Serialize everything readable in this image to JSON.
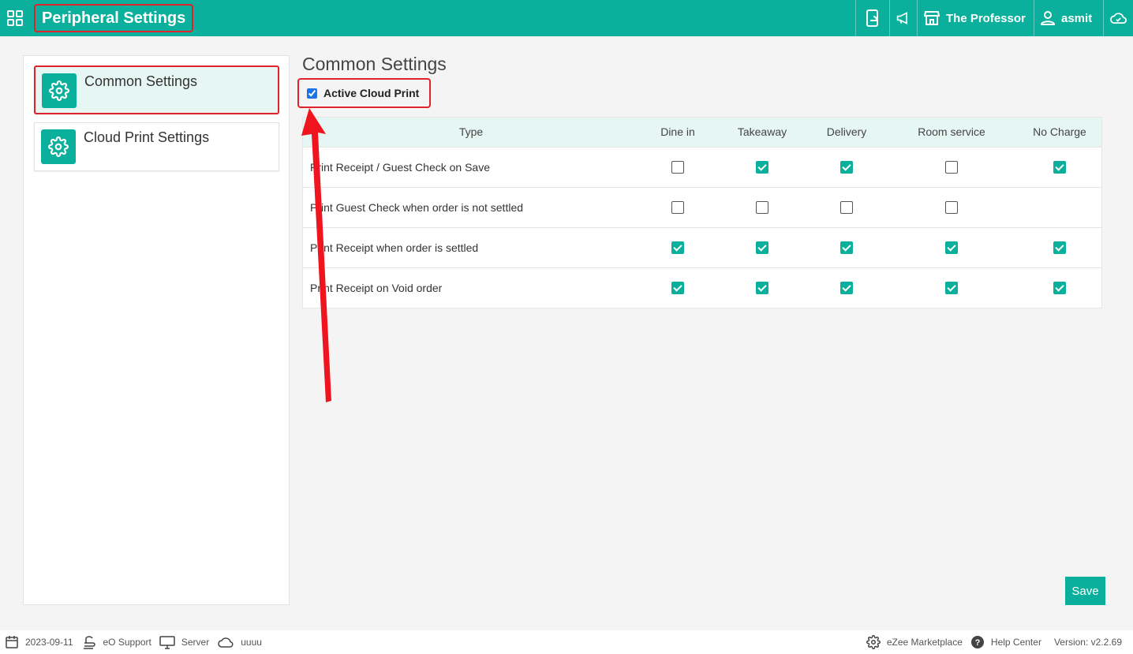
{
  "header": {
    "title": "Peripheral Settings",
    "property_name": "The Professor",
    "user_name": "asmit",
    "icons": [
      "grid-icon",
      "mobile-order-icon",
      "megaphone-icon",
      "store-icon",
      "user-icon",
      "cloud-check-icon"
    ]
  },
  "sidebar": {
    "items": [
      {
        "label": "Common Settings",
        "icon": "gear-icon",
        "active": true
      },
      {
        "label": "Cloud Print Settings",
        "icon": "gear-icon",
        "active": false
      }
    ]
  },
  "main": {
    "title": "Common Settings",
    "cloud_print": {
      "label": "Active Cloud Print",
      "checked": true
    }
  },
  "table": {
    "headers": [
      "Type",
      "Dine in",
      "Takeaway",
      "Delivery",
      "Room service",
      "No Charge"
    ],
    "rows": [
      {
        "type": "Print Receipt / Guest Check on Save",
        "values": [
          false,
          true,
          true,
          false,
          true
        ]
      },
      {
        "type": "Print Guest Check when order is not settled",
        "values": [
          false,
          false,
          false,
          false,
          null
        ]
      },
      {
        "type": "Print Receipt when order is settled",
        "values": [
          true,
          true,
          true,
          true,
          true
        ]
      },
      {
        "type": "Print Receipt on Void order",
        "values": [
          true,
          true,
          true,
          true,
          true
        ]
      }
    ]
  },
  "actions": {
    "save_label": "Save"
  },
  "footer": {
    "date": "2023-09-11",
    "support": "eO Support",
    "server": "Server",
    "cloud": "uuuu",
    "marketplace": "eZee Marketplace",
    "help": "Help Center",
    "version": "Version: v2.2.69"
  },
  "colors": {
    "accent": "#0bb09c",
    "highlight": "#e0222a",
    "row_active": "#e6f6f3"
  }
}
